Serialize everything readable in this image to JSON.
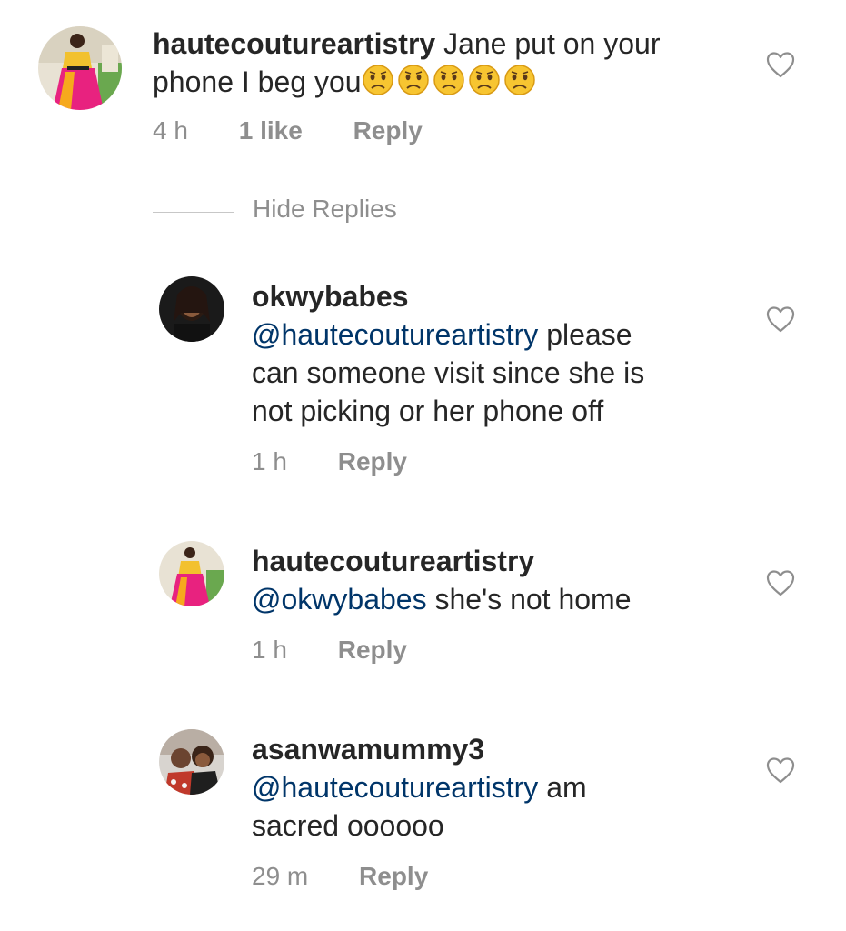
{
  "comments": [
    {
      "username": "hautecoutureartistry",
      "line1": "Jane put on your",
      "line2": "phone I beg you",
      "emojis": [
        "worried-face-emoji",
        "worried-face-emoji",
        "worried-face-emoji",
        "worried-face-emoji",
        "worried-face-emoji"
      ],
      "time": "4 h",
      "likes": "1 like",
      "reply": "Reply",
      "icon": "heart-outline-icon"
    },
    {
      "username": "okwybabes",
      "mention": "@hautecoutureartistry",
      "line1_rest": "please",
      "line2": "can someone visit since she is",
      "line3": "not picking or her phone off",
      "time": "1 h",
      "reply": "Reply",
      "icon": "heart-outline-icon"
    },
    {
      "username": "hautecoutureartistry",
      "mention": "@okwybabes",
      "line1_rest": "she's not home",
      "time": "1 h",
      "reply": "Reply",
      "icon": "heart-outline-icon"
    },
    {
      "username": "asanwamummy3",
      "mention": "@hautecoutureartistry",
      "line1_rest": "am",
      "line2": "sacred oooooo",
      "time": "29 m",
      "reply": "Reply",
      "icon": "heart-outline-icon"
    }
  ],
  "hide_replies": "Hide Replies",
  "colors": {
    "text": "#262626",
    "meta": "#8e8e8e",
    "mention": "#003569",
    "divider": "#c7c7c7"
  }
}
